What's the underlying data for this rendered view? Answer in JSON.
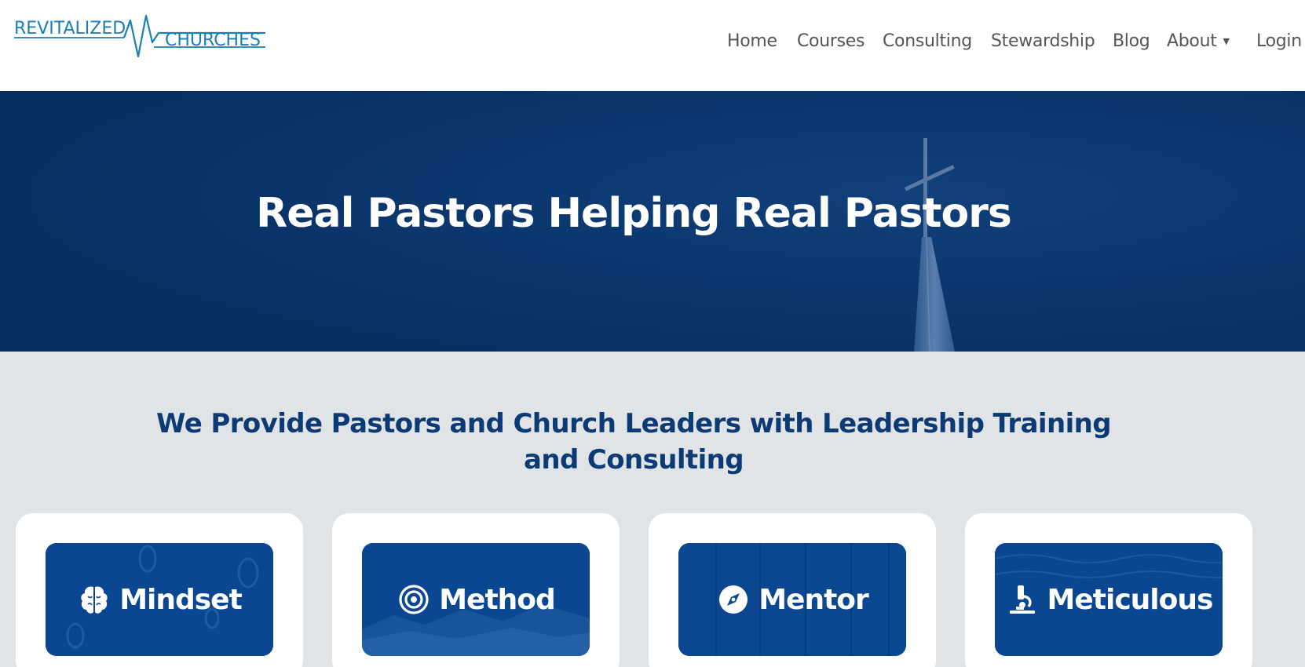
{
  "brand": {
    "line1": "REVITALIZED",
    "line2": "CHURCHES",
    "accent_color": "#1b7fb3"
  },
  "nav": {
    "items": [
      {
        "label": "Home"
      },
      {
        "label": "Courses"
      },
      {
        "label": "Consulting"
      },
      {
        "label": "Stewardship"
      },
      {
        "label": "Blog"
      },
      {
        "label": "About",
        "has_dropdown": true,
        "caret": "▼"
      },
      {
        "label": "Login"
      }
    ]
  },
  "hero": {
    "title": "Real Pastors Helping Real Pastors",
    "background_color": "#0a3871",
    "background_image": "church-steeple-cross"
  },
  "intro": {
    "line1": "We Provide Pastors and Church Leaders with Leadership Training",
    "line2": "and Consulting",
    "color": "#0c3a75"
  },
  "cards": [
    {
      "label": "Mindset",
      "icon": "brain-icon"
    },
    {
      "label": "Method",
      "icon": "target-icon"
    },
    {
      "label": "Mentor",
      "icon": "compass-icon"
    },
    {
      "label": "Meticulous",
      "icon": "microscope-icon"
    }
  ],
  "colors": {
    "page_background": "#e1e4e6",
    "card_background": "#ffffff",
    "tile_blue": "#0b458f"
  }
}
